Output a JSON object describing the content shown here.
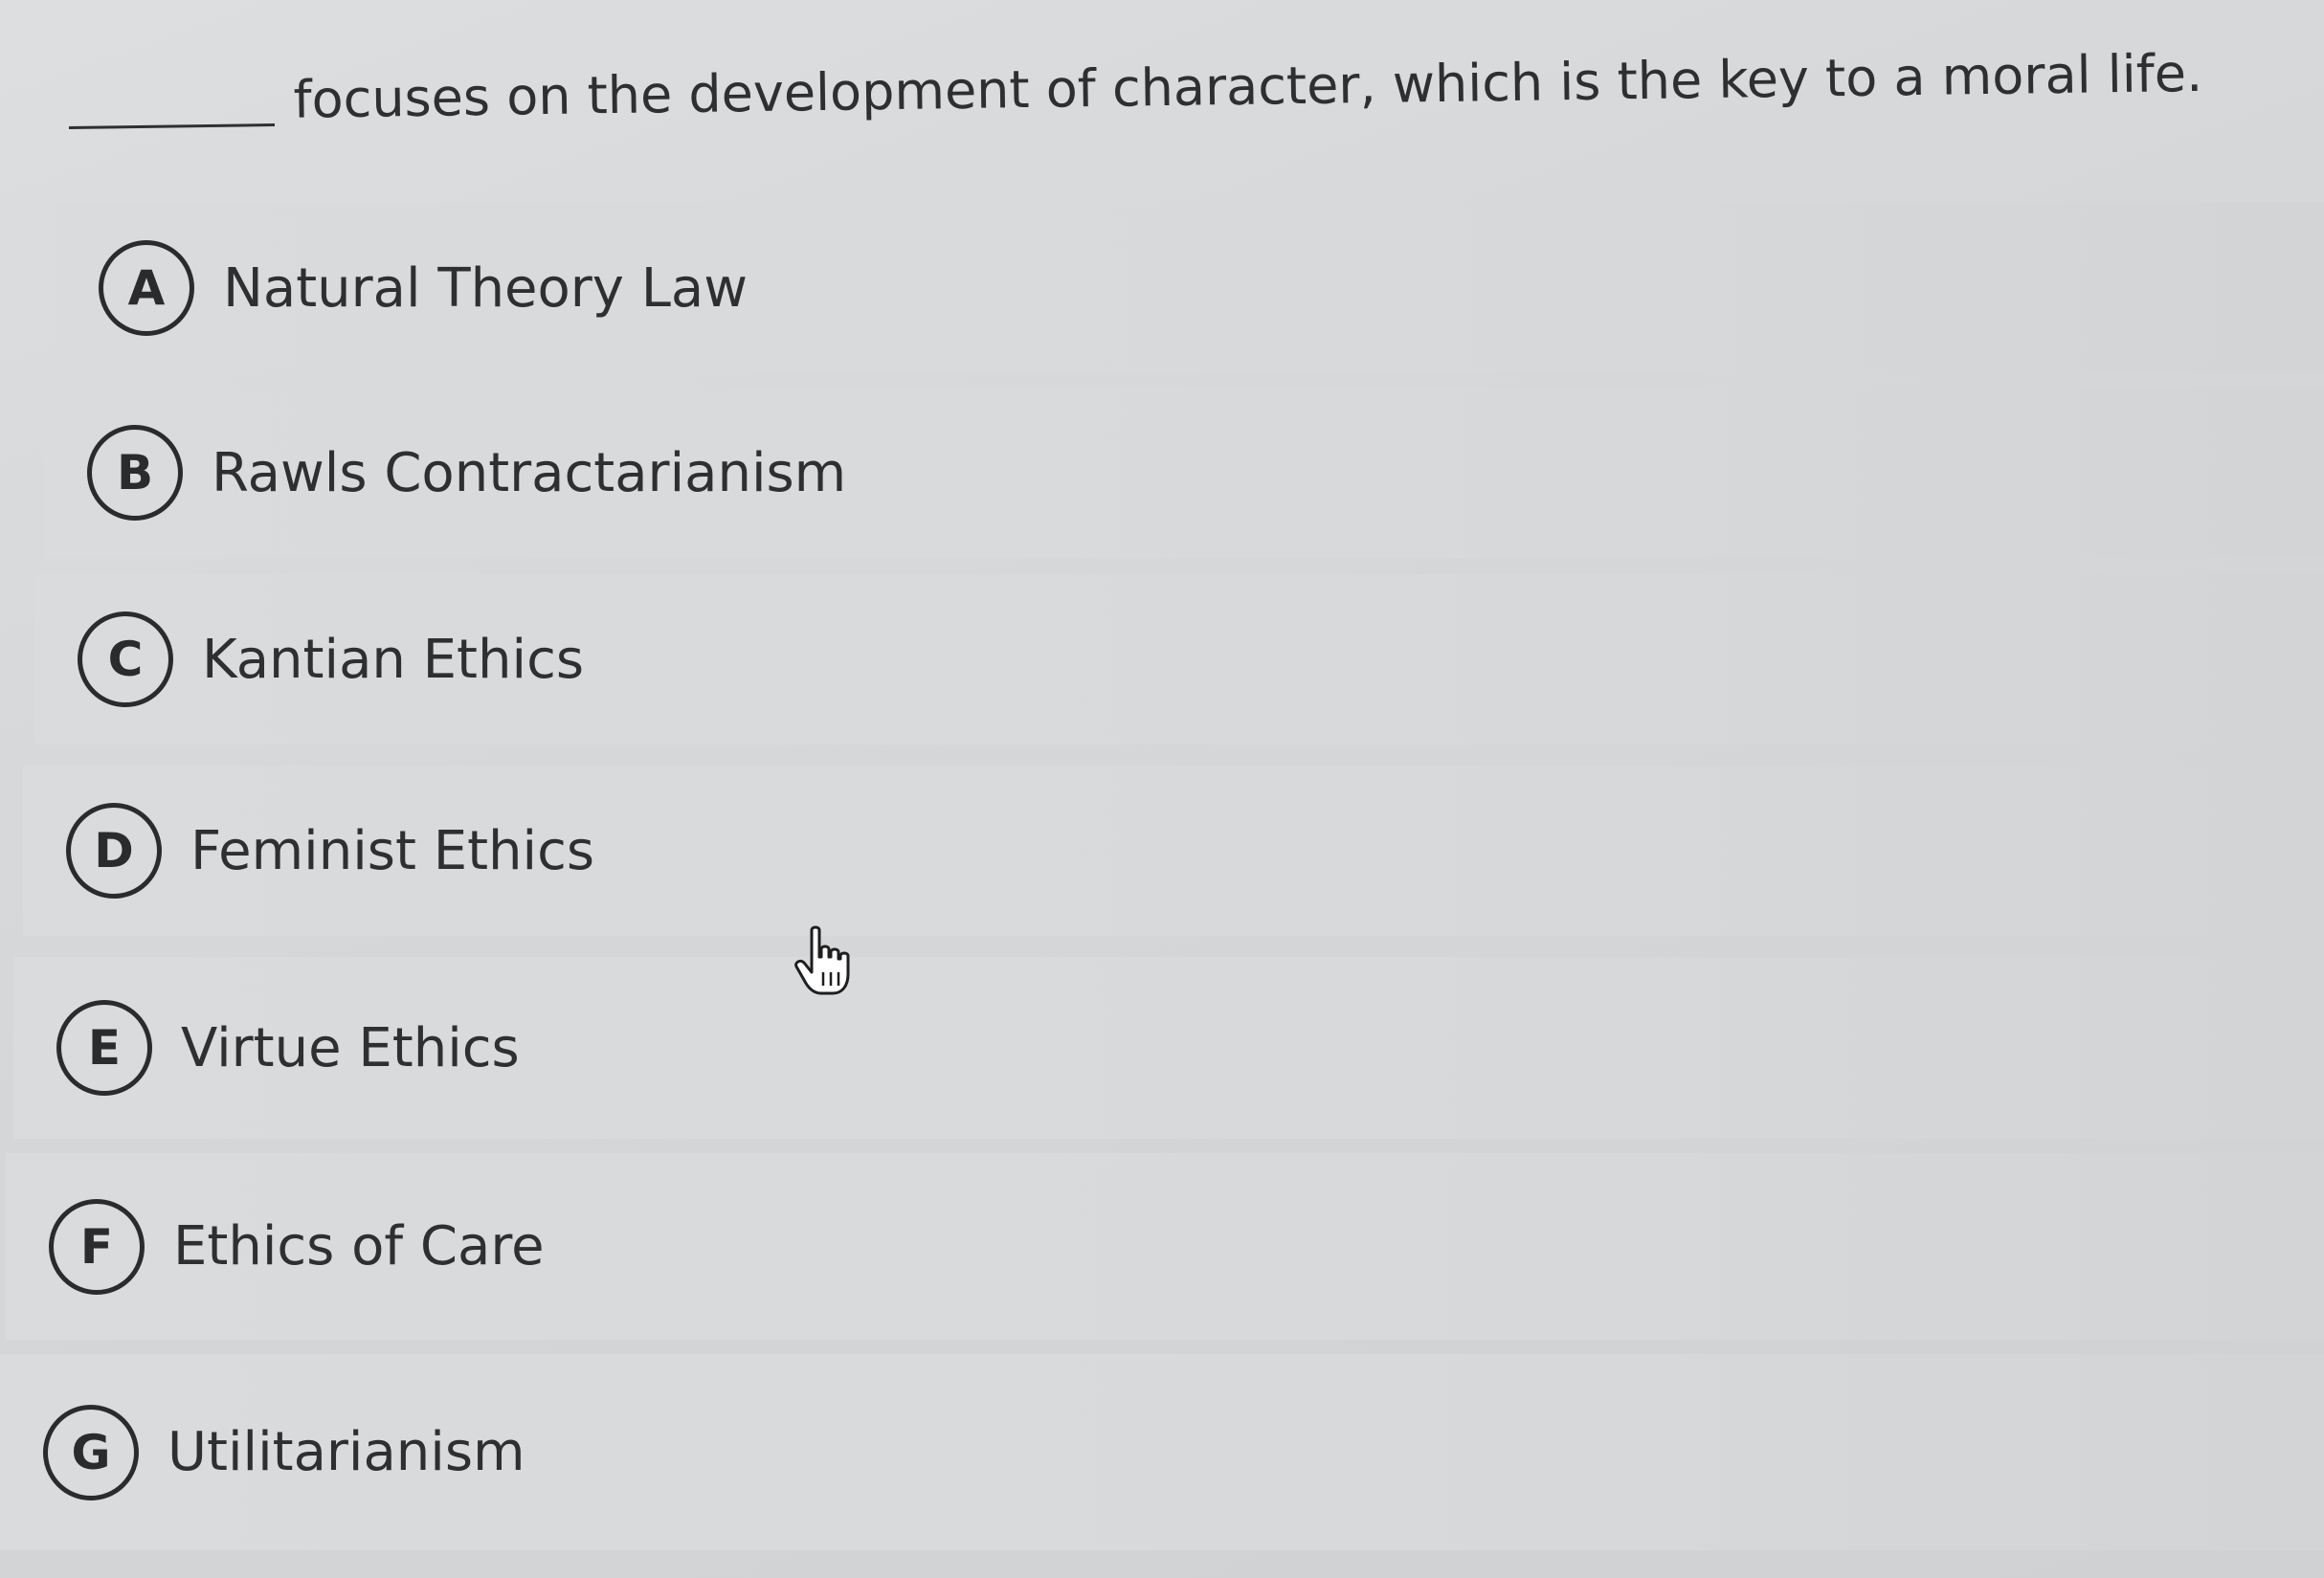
{
  "question": {
    "text": "focuses on the development of character, which is the key to a moral life."
  },
  "options": [
    {
      "letter": "A",
      "label": "Natural Theory Law"
    },
    {
      "letter": "B",
      "label": "Rawls Contractarianism"
    },
    {
      "letter": "C",
      "label": "Kantian Ethics"
    },
    {
      "letter": "D",
      "label": "Feminist Ethics"
    },
    {
      "letter": "E",
      "label": "Virtue Ethics"
    },
    {
      "letter": "F",
      "label": "Ethics of Care"
    },
    {
      "letter": "G",
      "label": "Utilitarianism"
    }
  ],
  "cursor": {
    "icon": "hand-pointer-icon"
  }
}
